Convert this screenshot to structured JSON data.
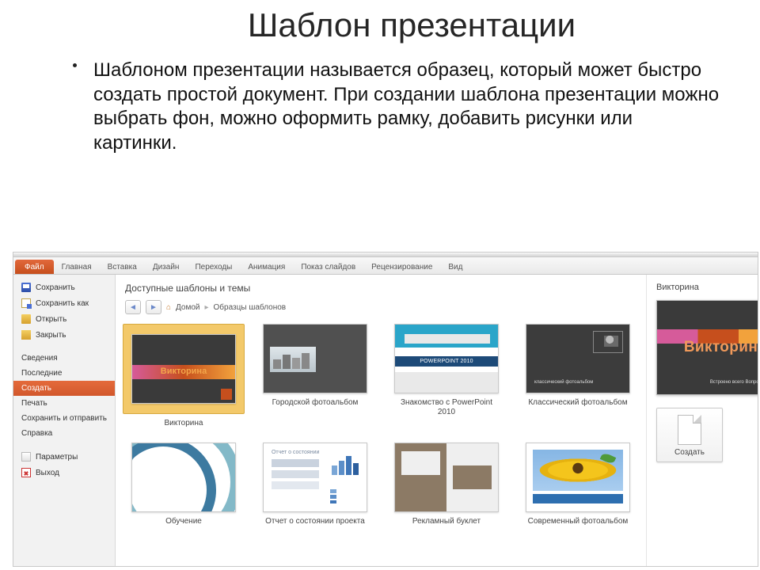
{
  "slide": {
    "title": "Шаблон презентации",
    "paragraph": "Шаблоном презентации называется образец, который может быстро создать простой документ. При создании шаблона презентации можно выбрать фон, можно оформить рамку, добавить рисунки или картинки."
  },
  "ribbon": {
    "file": "Файл",
    "tabs": [
      "Главная",
      "Вставка",
      "Дизайн",
      "Переходы",
      "Анимация",
      "Показ слайдов",
      "Рецензирование",
      "Вид"
    ]
  },
  "sidebar": {
    "save": "Сохранить",
    "save_as": "Сохранить как",
    "open": "Открыть",
    "close": "Закрыть",
    "info": "Сведения",
    "recent": "Последние",
    "create": "Создать",
    "print": "Печать",
    "share": "Сохранить и отправить",
    "help": "Справка",
    "options": "Параметры",
    "exit": "Выход"
  },
  "gallery": {
    "heading": "Доступные шаблоны и темы",
    "breadcrumb": {
      "home": "Домой",
      "current": "Образцы шаблонов"
    },
    "templates": [
      {
        "label": "Викторина"
      },
      {
        "label": "Городской фотоальбом"
      },
      {
        "label": "Знакомство с PowerPoint 2010"
      },
      {
        "label": "Классический фотоальбом"
      },
      {
        "label": "Обучение"
      },
      {
        "label": "Отчет о состоянии проекта"
      },
      {
        "label": "Рекламный буклет"
      },
      {
        "label": "Современный фотоальбом"
      }
    ],
    "ppt_badge": "POWERPOINT 2010",
    "classic_caption": "классический фотоальбом",
    "report_caption": "Отчет о состоянии",
    "modern_caption": "Современный фотоальбом"
  },
  "preview": {
    "title": "Викторина",
    "big_label": "Викторина",
    "small_label": "Встроено всего\nВопросы и ответы",
    "create_label": "Создать"
  }
}
